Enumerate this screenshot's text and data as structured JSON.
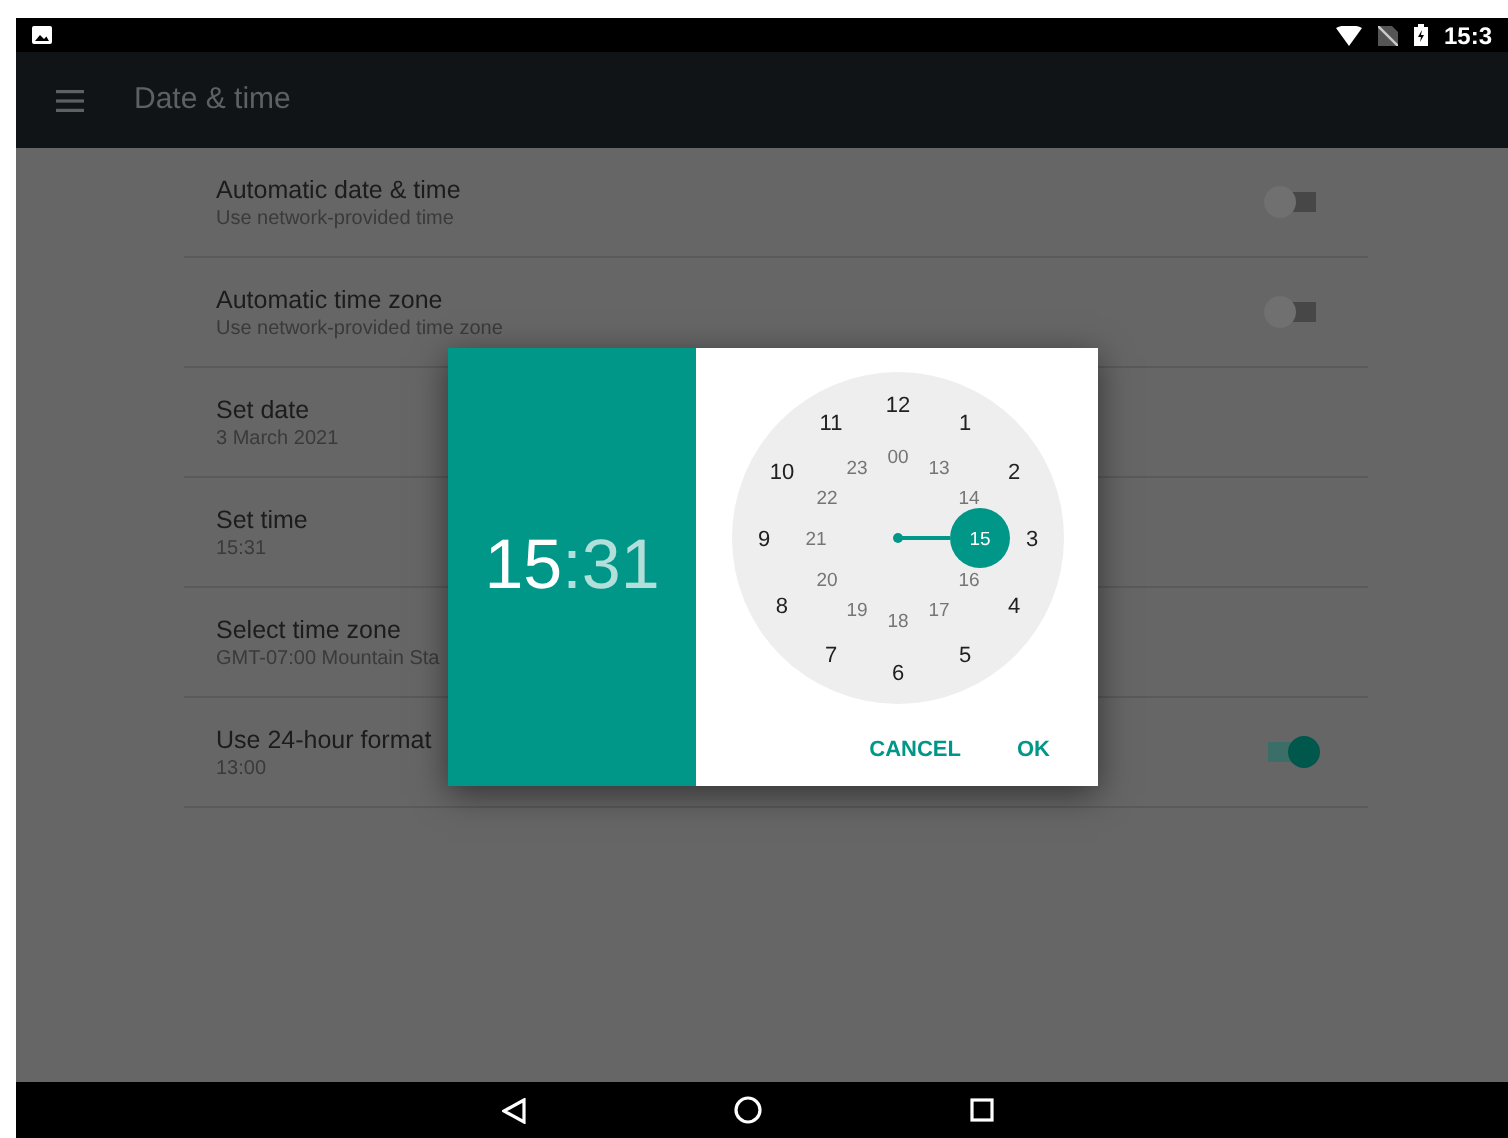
{
  "status_bar": {
    "time": "15:3"
  },
  "toolbar": {
    "title": "Date & time"
  },
  "settings": [
    {
      "kind": "switch",
      "title": "Automatic date & time",
      "summary": "Use network-provided time",
      "on": false
    },
    {
      "kind": "switch",
      "title": "Automatic time zone",
      "summary": "Use network-provided time zone",
      "on": false
    },
    {
      "kind": "plain",
      "title": "Set date",
      "summary": "3 March 2021"
    },
    {
      "kind": "plain",
      "title": "Set time",
      "summary": "15:31"
    },
    {
      "kind": "plain",
      "title": "Select time zone",
      "summary": "GMT-07:00 Mountain Sta"
    },
    {
      "kind": "switch",
      "title": "Use 24-hour format",
      "summary": "13:00",
      "on": true
    }
  ],
  "dialog": {
    "header": {
      "hour": "15",
      "separator": ":",
      "minute": "31",
      "hour_selected": true,
      "minute_selected": false
    },
    "dial_outer": [
      {
        "label": "12",
        "selected": false
      },
      {
        "label": "1",
        "selected": false
      },
      {
        "label": "2",
        "selected": false
      },
      {
        "label": "3",
        "selected": false
      },
      {
        "label": "4",
        "selected": false
      },
      {
        "label": "5",
        "selected": false
      },
      {
        "label": "6",
        "selected": false
      },
      {
        "label": "7",
        "selected": false
      },
      {
        "label": "8",
        "selected": false
      },
      {
        "label": "9",
        "selected": false
      },
      {
        "label": "10",
        "selected": false
      },
      {
        "label": "11",
        "selected": false
      }
    ],
    "dial_inner": [
      {
        "label": "00",
        "selected": false
      },
      {
        "label": "13",
        "selected": false
      },
      {
        "label": "14",
        "selected": false
      },
      {
        "label": "15",
        "selected": true
      },
      {
        "label": "16",
        "selected": false
      },
      {
        "label": "17",
        "selected": false
      },
      {
        "label": "18",
        "selected": false
      },
      {
        "label": "19",
        "selected": false
      },
      {
        "label": "20",
        "selected": false
      },
      {
        "label": "21",
        "selected": false
      },
      {
        "label": "22",
        "selected": false
      },
      {
        "label": "23",
        "selected": false
      }
    ],
    "buttons": [
      "CANCEL",
      "OK"
    ]
  }
}
